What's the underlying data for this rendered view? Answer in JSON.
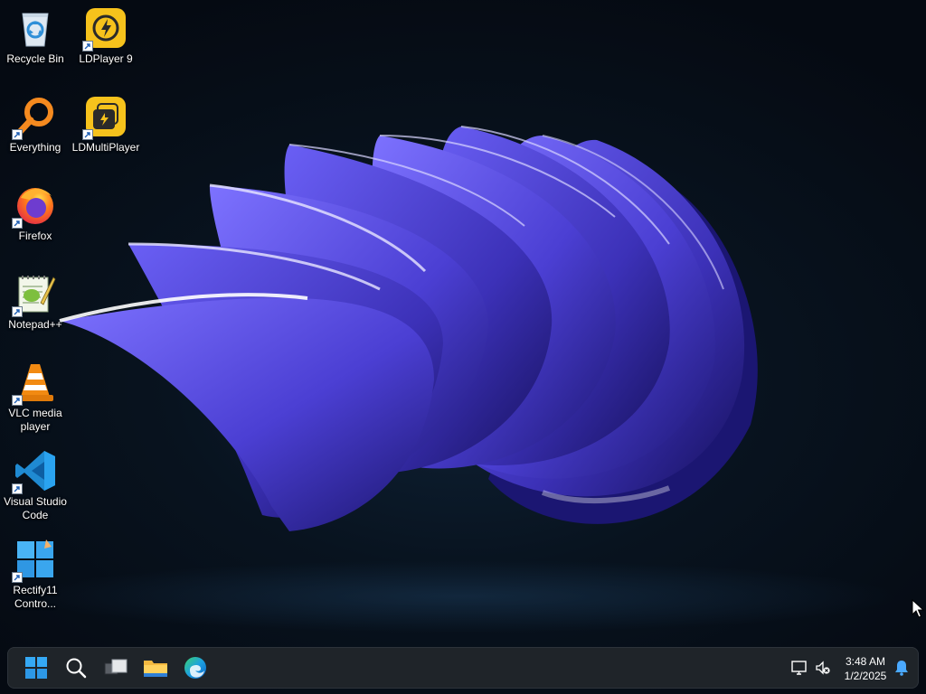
{
  "desktop": {
    "icons": [
      {
        "label": "Recycle Bin",
        "icon": "recycle-bin-icon"
      },
      {
        "label": "LDPlayer 9",
        "icon": "ldplayer-icon"
      },
      {
        "label": "Everything",
        "icon": "everything-search-icon"
      },
      {
        "label": "LDMultiPlayer",
        "icon": "ldmultiplayer-icon"
      },
      {
        "label": "Firefox",
        "icon": "firefox-icon"
      },
      {
        "label": "Notepad++",
        "icon": "notepad-plus-plus-icon"
      },
      {
        "label": "VLC media player",
        "icon": "vlc-icon"
      },
      {
        "label": "Visual Studio Code",
        "icon": "vscode-icon"
      },
      {
        "label": "Rectify11 Contro...",
        "icon": "rectify11-icon"
      }
    ]
  },
  "taskbar": {
    "buttons": [
      "start-icon",
      "search-icon",
      "task-view-icon",
      "file-explorer-icon",
      "edge-icon"
    ],
    "tray": {
      "time": "3:48 AM",
      "date": "1/2/2025"
    }
  },
  "colors": {
    "background": "#07111c",
    "taskbar": "#1f2429",
    "petal": "#4a3fd6",
    "petal_light": "#8d84ff"
  }
}
